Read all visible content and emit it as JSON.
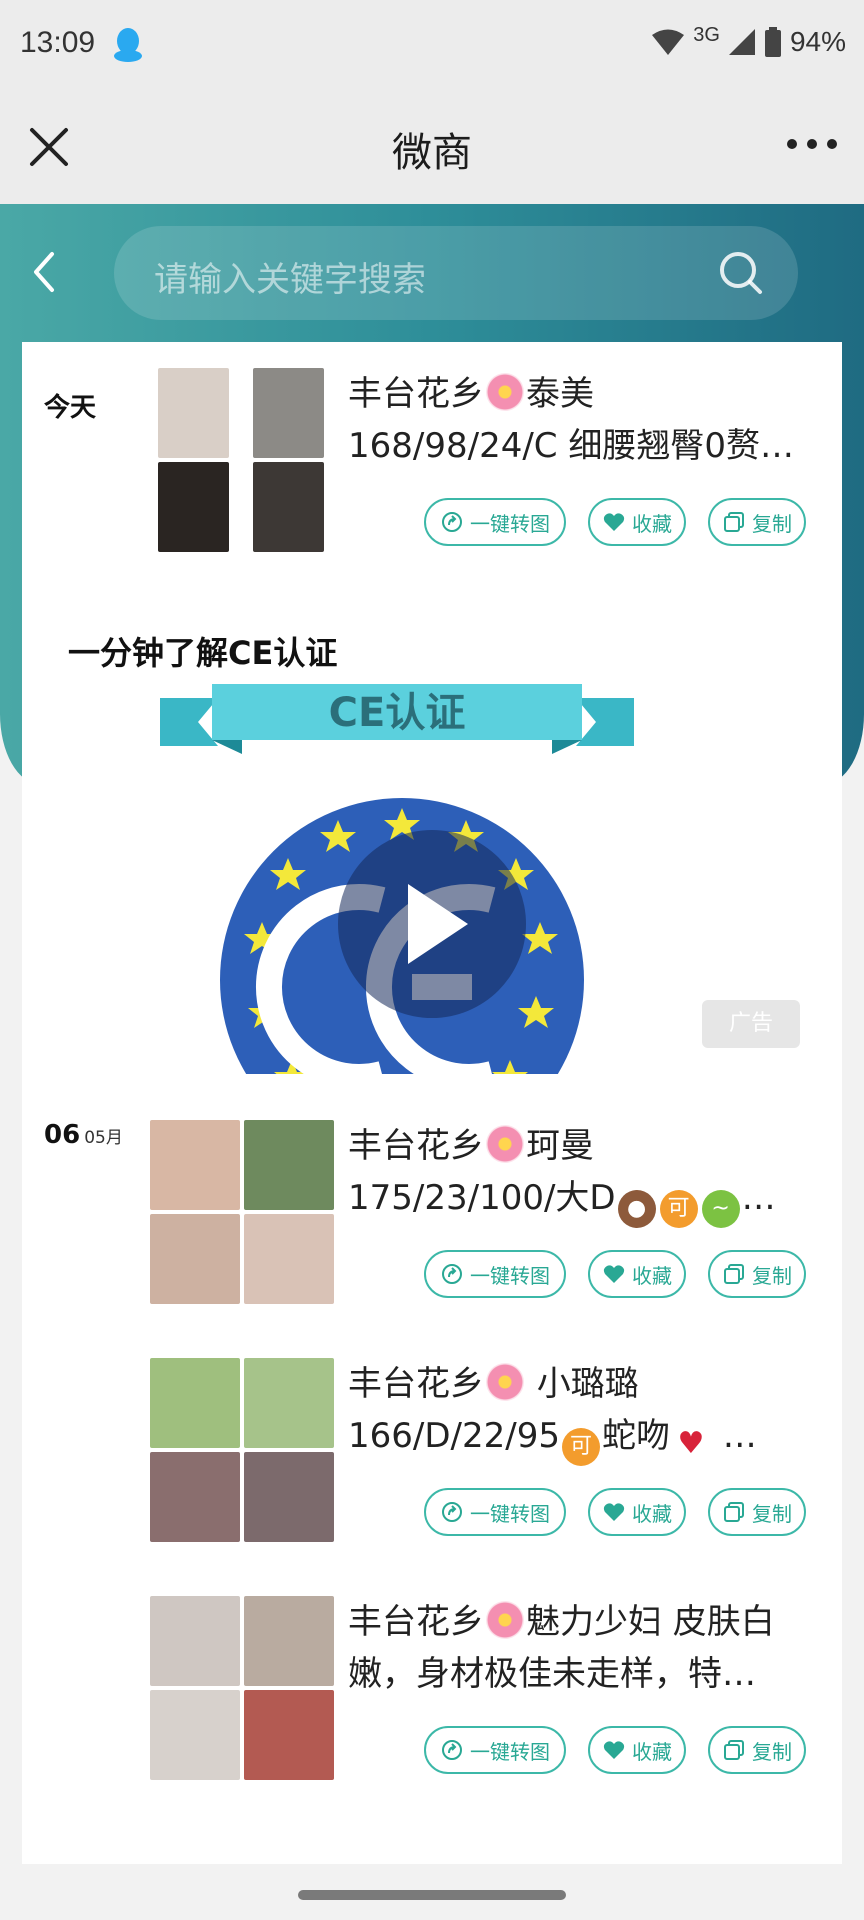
{
  "status_bar": {
    "time": "13:09",
    "network": "3G",
    "battery": "94%"
  },
  "title_bar": {
    "title": "微商"
  },
  "search": {
    "placeholder": "请输入关键字搜索"
  },
  "feed": [
    {
      "date_day": "今天",
      "title_prefix": "丰台花乡",
      "title_suffix": "泰美",
      "line2": "168/98/24/C 细腰翘臀0赘…",
      "thumb_colors": [
        "#d9cfc7",
        "#8c8a86",
        "#2a2522",
        "#3d3835"
      ]
    },
    {
      "date_day": "06",
      "date_month": "05月",
      "title_prefix": "丰台花乡",
      "title_suffix": "珂曼",
      "line2_prefix": "175/23/100/大D",
      "line2_suffix": "…",
      "thumb_colors": [
        "#d8b7a4",
        "#6e8a5e",
        "#cdb1a1",
        "#d9c2b6"
      ]
    },
    {
      "title_prefix": "丰台花乡",
      "title_suffix": " 小璐璐",
      "line2_prefix": "166/D/22/95",
      "line2_mid": "蛇吻",
      "line2_suffix": " …",
      "thumb_colors": [
        "#9fbf7e",
        "#a6c38a",
        "#8a6e6e",
        "#7c6a6c"
      ]
    },
    {
      "title_prefix": "丰台花乡",
      "title_suffix": "魅力少妇 皮肤白",
      "line2": "嫩，身材极佳未走样，特…",
      "thumb_colors": [
        "#cfc7c2",
        "#b9aba0",
        "#d7d1cc",
        "#b35a52"
      ]
    }
  ],
  "actions": {
    "share": "一键转图",
    "favorite": "收藏",
    "copy": "复制"
  },
  "ad": {
    "title": "一分钟了解CE认证",
    "banner_text": "CE认证",
    "badge": "广告"
  },
  "colors": {
    "accent": "#3cb8a8",
    "header_teal": "#2e8e99"
  }
}
